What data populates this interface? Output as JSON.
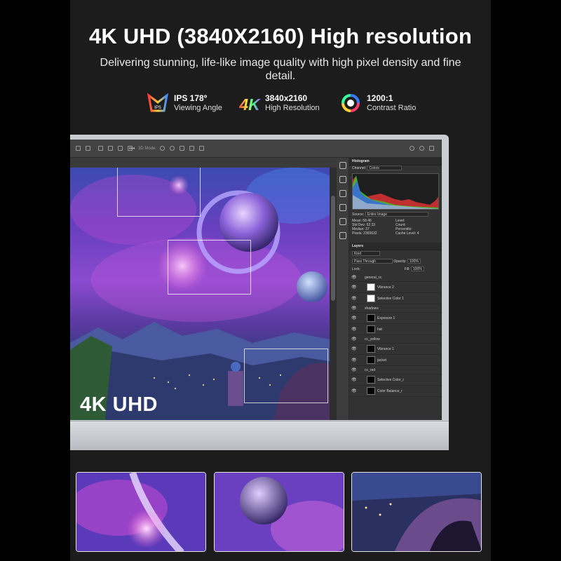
{
  "headline": "4K UHD (3840X2160) High resolution",
  "subline": "Delivering stunning, life-like image quality with high pixel density and fine detail.",
  "features": [
    {
      "icon": "ips-icon",
      "title": "IPS 178º",
      "caption": "Viewing Angle"
    },
    {
      "icon": "4k-icon",
      "title": "3840x2160",
      "caption": "High Resolution"
    },
    {
      "icon": "contrast-ring-icon",
      "title": "1200:1",
      "caption": "Contrast Ratio"
    }
  ],
  "canvas_label": "4K UHD",
  "toolbar": {
    "mode_label": "3D Mode:"
  },
  "histogram": {
    "title": "Histogram",
    "channel_label": "Channel:",
    "channel_value": "Colors",
    "source_label": "Source:",
    "source_value": "Entire Image",
    "stats_left": [
      "Mean: 58.46",
      "Std Dev: 62.33",
      "Median: 37",
      "Pixels: 2365632"
    ],
    "stats_right": [
      "Level:",
      "Count:",
      "Percentile:",
      "Cache Level: 4"
    ]
  },
  "layers": {
    "title": "Layers",
    "kind_label": "Kind",
    "blend_mode": "Pass Through",
    "opacity_label": "Opacity:",
    "opacity_value": "100%",
    "lock_label": "Lock:",
    "fill_label": "Fill:",
    "fill_value": "100%",
    "items": [
      {
        "name": "general_cc",
        "type": "group"
      },
      {
        "name": "Vibrance 2",
        "type": "adj"
      },
      {
        "name": "Selective Color 1",
        "type": "adj"
      },
      {
        "name": "shadows",
        "type": "group"
      },
      {
        "name": "Exposure 1",
        "type": "adj"
      },
      {
        "name": "hat",
        "type": "group"
      },
      {
        "name": "cc_yellow",
        "type": "group"
      },
      {
        "name": "Vibrance 1",
        "type": "adj"
      },
      {
        "name": "jacket",
        "type": "group"
      },
      {
        "name": "cc_red",
        "type": "group"
      },
      {
        "name": "Selective Color_r",
        "type": "adj"
      },
      {
        "name": "Color Balance_r",
        "type": "adj"
      }
    ]
  },
  "colors": {
    "background": "#1c1c1c",
    "panel": "#323232",
    "bezel": "#c9ccd0"
  }
}
